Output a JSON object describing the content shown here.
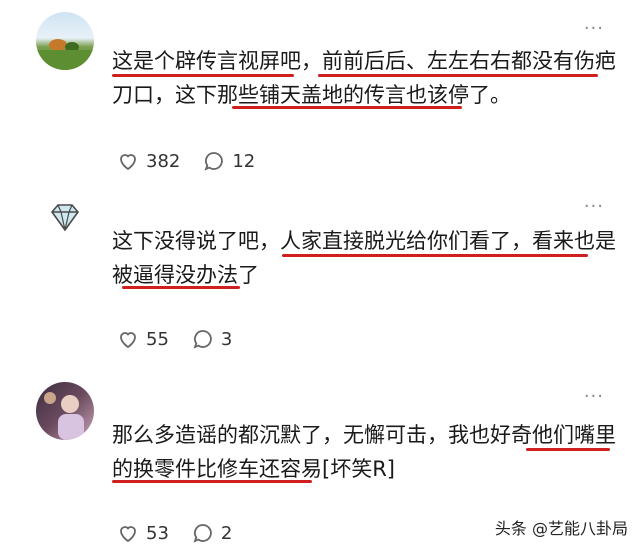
{
  "comments": [
    {
      "avatar": "landscape-avatar",
      "line1": "这是个辟传言视屏吧，前前后后、左左右右都没有伤疤",
      "line2": "刀口，这下那些铺天盖地的传言也该停了。",
      "likes": "382",
      "replies": "12"
    },
    {
      "avatar": "diamond-avatar",
      "line1": "这下没得说了吧，人家直接脱光给你们看了，看来也是",
      "line2": "被逼得没办法了",
      "likes": "55",
      "replies": "3"
    },
    {
      "avatar": "photo-avatar",
      "line1": "那么多造谣的都沉默了，无懈可击，我也好奇他们嘴里",
      "line2": "的换零件比修车还容易[坏笑R]",
      "likes": "53",
      "replies": "2"
    }
  ],
  "more_label": "···",
  "watermark": "头条 @艺能八卦局",
  "colors": {
    "underline": "#d01f1f",
    "icon": "#666666",
    "diamond": "#b9dde6"
  }
}
